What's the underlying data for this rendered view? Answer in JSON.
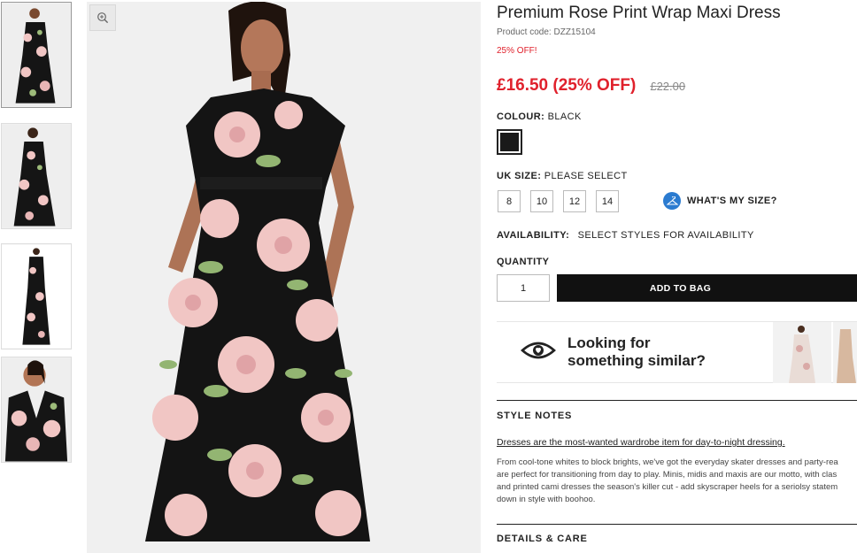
{
  "gallery": {
    "thumbnails": [
      "front view",
      "back view",
      "full length",
      "close up"
    ],
    "zoom_icon": "zoom-in-icon"
  },
  "product": {
    "title": "Premium Rose Print Wrap Maxi Dress",
    "code": "Product code: DZZ15104",
    "discount_note": "25% OFF!",
    "price": "£16.50 (25% OFF)",
    "was_price": "£22.00",
    "colour_label": "COLOUR:",
    "colour_value": "BLACK",
    "swatch_color": "#1a1a1a",
    "size_label": "UK SIZE:",
    "size_value": "PLEASE SELECT",
    "sizes": [
      "8",
      "10",
      "12",
      "14"
    ],
    "whats_my_size": "WHAT'S MY SIZE?",
    "availability_label": "AVAILABILITY:",
    "availability_value": "SELECT STYLES FOR AVAILABILITY",
    "quantity_label": "QUANTITY",
    "quantity_value": "1",
    "add_to_bag": "ADD TO BAG"
  },
  "similar": {
    "line1": "Looking for",
    "line2": "something similar?",
    "icon": "eye-icon"
  },
  "style_notes": {
    "heading": "STYLE NOTES",
    "lead": "Dresses are the most-wanted wardrobe item for day-to-night dressing.",
    "body": [
      "From cool-tone whites to block brights, we've got the everyday skater dresses and party-rea",
      "are perfect for transitioning from day to play. Minis, midis and maxis are our motto, with clas",
      "and printed cami dresses the season's killer cut - add skyscraper heels for a seriolsy statem",
      "down in style with boohoo."
    ]
  },
  "details_care": {
    "heading": "DETAILS & CARE"
  },
  "colors": {
    "accent": "#e0212c",
    "button": "#111111",
    "help_icon": "#2b7bd0"
  }
}
